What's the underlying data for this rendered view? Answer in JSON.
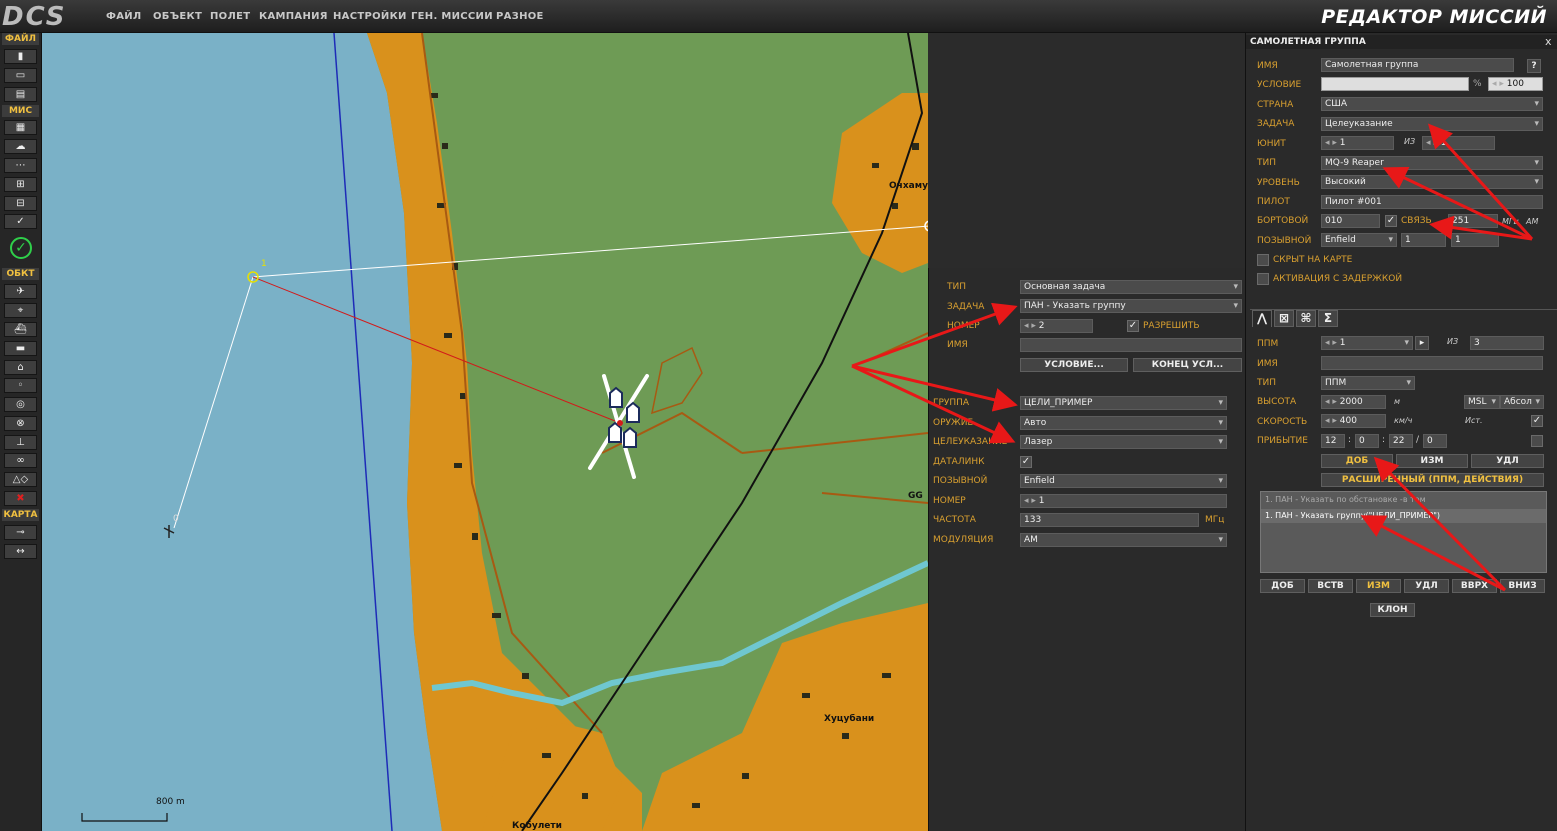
{
  "app": {
    "logo": "DCS",
    "title": "РЕДАКТОР МИССИЙ"
  },
  "menu": [
    "ФАЙЛ",
    "ОБЪЕКТ",
    "ПОЛЕТ",
    "КАМПАНИЯ",
    "НАСТРОЙКИ",
    "ГЕН. МИССИИ",
    "РАЗНОЕ"
  ],
  "toolbar": {
    "file_header": "ФАЙЛ",
    "mission_header": "МИС",
    "object_header": "ОБКТ",
    "map_header": "КАРТА",
    "icons": [
      "new-file-icon",
      "open-folder-icon",
      "save-icon",
      "briefing-icon",
      "weather-icon",
      "triggers-icon",
      "goals-icon",
      "resources-icon",
      "check-icon",
      "airplane-icon",
      "helicopter-icon",
      "ship-icon",
      "tank-icon",
      "static-icon",
      "waypoint-icon",
      "target-icon",
      "no-fly-icon",
      "ground-icon",
      "group-icon",
      "shapes-icon",
      "delete-icon",
      "ruler-icon",
      "measure-icon"
    ]
  },
  "map": {
    "town1": "Очхамури",
    "town2": "Хуцубани",
    "town3": "Кобулети",
    "wp0": "0",
    "wp1": "1",
    "wp2": "2",
    "scale": "800 m",
    "partial_label": "GG"
  },
  "group_panel": {
    "title": "САМОЛЕТНАЯ ГРУППА",
    "close": "x",
    "help": "?",
    "name_label": "ИМЯ",
    "name_value": "Самолетная группа",
    "condition_label": "УСЛОВИЕ",
    "condition_value": "",
    "percent": "%",
    "probability": "100",
    "country_label": "СТРАНА",
    "country_value": "США",
    "task_label": "ЗАДАЧА",
    "task_value": "Целеуказание",
    "unit_label": "ЮНИТ",
    "unit_value": "1",
    "of_label": "ИЗ",
    "unit_total": "1",
    "type_label": "ТИП",
    "type_value": "MQ-9 Reaper",
    "skill_label": "УРОВЕНЬ",
    "skill_value": "Высокий",
    "pilot_label": "ПИЛОТ",
    "pilot_value": "Пилот #001",
    "board_label": "БОРТОВОЙ",
    "board_value": "010",
    "radio_label": "СВЯЗЬ",
    "radio_checked": true,
    "radio_value": "251",
    "radio_unit": "МГц",
    "modulation": "AM",
    "callsign_label": "ПОЗЫВНОЙ",
    "callsign_value": "Enfield",
    "callsign_n1": "1",
    "callsign_n2": "1",
    "hidden_label": "СКРЫТ НА КАРТЕ",
    "late_label": "АКТИВАЦИЯ С ЗАДЕРЖКОЙ",
    "tabs": [
      "route-icon",
      "triggered-actions-icon",
      "payload-icon",
      "summary-icon"
    ]
  },
  "route_panel": {
    "wp_label": "ППМ",
    "wp_value": "1",
    "of_label": "ИЗ",
    "wp_total": "3",
    "name_label": "ИМЯ",
    "name_value": "",
    "type_label": "ТИП",
    "type_value": "ППМ",
    "alt_label": "ВЫСОТА",
    "alt_value": "2000",
    "alt_unit": "м",
    "alt_mode": "MSL",
    "alt_ref": "Абсол",
    "speed_label": "СКОРОСТЬ",
    "speed_value": "400",
    "speed_unit": "км/ч",
    "true_label": "Ист.",
    "true_checked": true,
    "eta_label": "ПРИБЫТИЕ",
    "eta_h": "12",
    "eta_m": "0",
    "eta_s": "22",
    "eta_d": "0",
    "add": "ДОБ",
    "edit": "ИЗМ",
    "del": "УДЛ",
    "advanced": "РАСШИРЕННЫЙ (ППМ, ДЕЙСТВИЯ)",
    "actions": [
      "1. ПАН - Указать по обстановке -в том",
      "1. ПАН - Указать группу(\"ЦЕЛИ_ПРИМЕР\")"
    ],
    "add2": "ДОБ",
    "insert": "ВСТВ",
    "edit2": "ИЗМ",
    "del2": "УДЛ",
    "up": "ВВРХ",
    "down": "ВНИЗ",
    "clone": "КЛОН"
  },
  "action_panel": {
    "type_label": "ТИП",
    "type_value": "Основная задача",
    "task_label": "ЗАДАЧА",
    "task_value": "ПАН - Указать группу",
    "number_label": "НОМЕР",
    "number_value": "2",
    "enable_label": "РАЗРЕШИТЬ",
    "enable_checked": true,
    "name_label": "ИМЯ",
    "name_value": "",
    "cond_button": "УСЛОВИЕ...",
    "stop_button": "КОНЕЦ УСЛ...",
    "group_label": "ГРУППА",
    "group_value": "ЦЕЛИ_ПРИМЕР",
    "weapon_label": "ОРУЖИЕ",
    "weapon_value": "Авто",
    "designation_label": "ЦЕЛЕУКАЗАНИЕ",
    "designation_value": "Лазер",
    "datalink_label": "ДАТАЛИНК",
    "datalink_checked": true,
    "callsign_label": "ПОЗЫВНОЙ",
    "callsign_value": "Enfield",
    "num_label": "НОМЕР",
    "num_value": "1",
    "freq_label": "ЧАСТОТА",
    "freq_value": "133",
    "freq_unit": "МГц",
    "mod_label": "МОДУЛЯЦИЯ",
    "mod_value": "AM"
  },
  "colors": {
    "water": "#7ab1c7",
    "land": "#6e9b55",
    "urban": "#d9911c",
    "label": "#d9a030",
    "arrow": "#e81818"
  }
}
